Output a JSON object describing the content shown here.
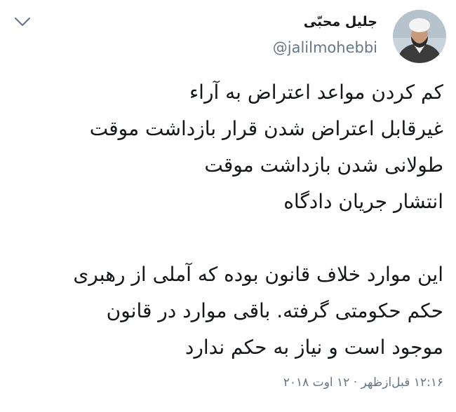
{
  "tweet": {
    "author_name": "جلیل محبّی",
    "author_handle": "@jalilmohebbi",
    "lines": [
      "کم کردن مواعد اعتراض به آراء",
      "غیرقابل اعتراض شدن قرار بازداشت موقت",
      "طولانی شدن بازداشت موقت",
      "انتشار جریان دادگاه",
      "",
      "این موارد خلاف قانون بوده که آملی از رهبری",
      "حکم حکومتی گرفته. باقی موارد در قانون",
      "موجود است و نیاز به حکم ندارد"
    ],
    "timestamp": "۱۲:۱۶ قبل‌ازظهر · ۱۲ اوت ۲۰۱۸"
  },
  "icons": {
    "menu": "chevron-down-icon",
    "avatar": "profile-photo"
  },
  "colors": {
    "text": "#14171a",
    "secondary": "#657786",
    "background": "#ffffff"
  }
}
